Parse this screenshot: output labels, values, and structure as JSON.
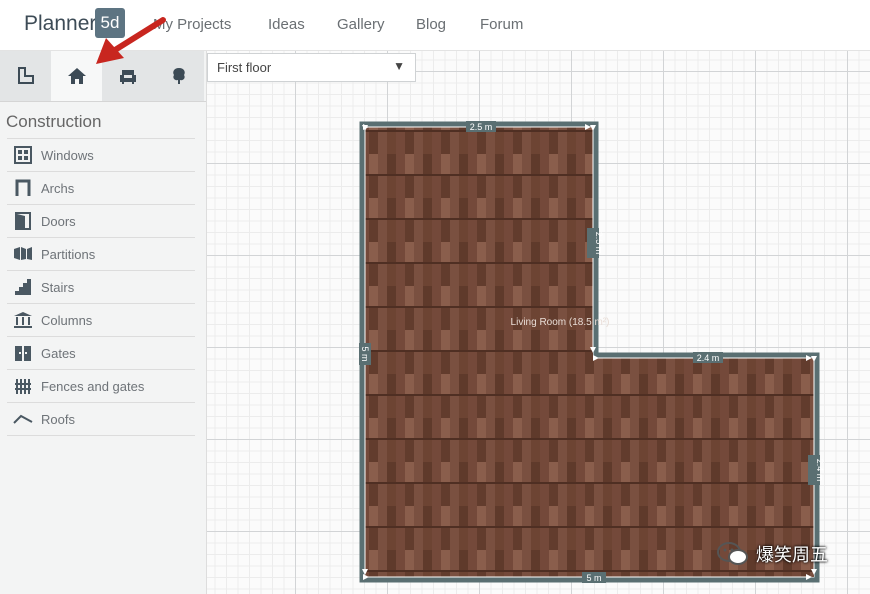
{
  "app": {
    "logo_text": "Planner",
    "logo_badge": "5d"
  },
  "nav": {
    "items": [
      "My Projects",
      "Ideas",
      "Gallery",
      "Blog",
      "Forum"
    ]
  },
  "sidebar": {
    "tabs": [
      {
        "name": "tab-construction",
        "icon": "floorplan-icon"
      },
      {
        "name": "tab-interior",
        "icon": "home-icon",
        "active": true
      },
      {
        "name": "tab-furniture",
        "icon": "armchair-icon"
      },
      {
        "name": "tab-exterior",
        "icon": "tree-icon"
      }
    ],
    "section_title": "Construction",
    "items": [
      {
        "label": "Windows",
        "icon": "window-icon"
      },
      {
        "label": "Archs",
        "icon": "arch-icon"
      },
      {
        "label": "Doors",
        "icon": "door-icon"
      },
      {
        "label": "Partitions",
        "icon": "partition-icon"
      },
      {
        "label": "Stairs",
        "icon": "stairs-icon"
      },
      {
        "label": "Columns",
        "icon": "columns-icon"
      },
      {
        "label": "Gates",
        "icon": "gate-icon"
      },
      {
        "label": "Fences and gates",
        "icon": "fence-icon"
      },
      {
        "label": "Roofs",
        "icon": "roof-icon"
      }
    ]
  },
  "floor_select": {
    "value": "First floor"
  },
  "room": {
    "label": "Living Room (18.5 m²)",
    "dims": {
      "top": "2.5 m",
      "right_upper": "2.5 m",
      "step": "2.4 m",
      "right_lower": "2.4 m",
      "bottom": "5 m",
      "left": "5 m"
    }
  },
  "watermark": {
    "text": "爆笑周五"
  },
  "colors": {
    "wall": "#5a6f72",
    "floor": "#6d4433",
    "arrow": "#c8261f"
  }
}
